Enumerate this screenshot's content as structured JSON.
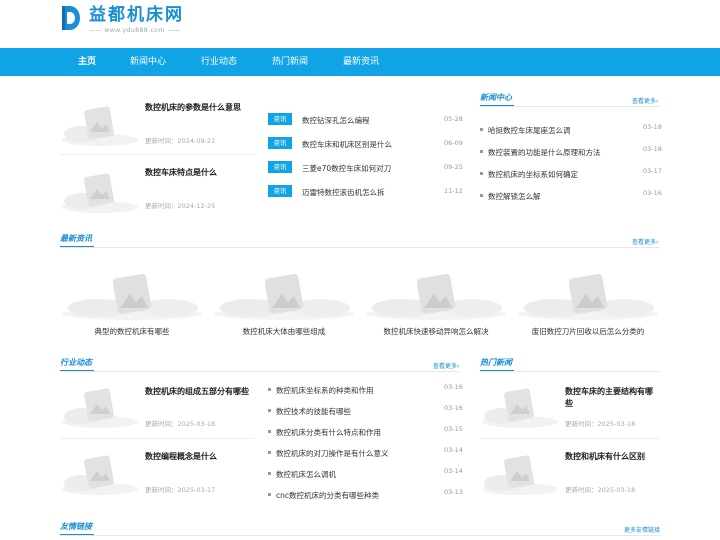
{
  "site": {
    "name": "益都机床网",
    "url": "—— www.ydu888.com ——"
  },
  "nav": [
    {
      "label": "主页"
    },
    {
      "label": "新闻中心"
    },
    {
      "label": "行业动态"
    },
    {
      "label": "热门新闻"
    },
    {
      "label": "最新资讯"
    }
  ],
  "top": {
    "cards": [
      {
        "title": "数控机床的参数是什么意思",
        "time": "更新时间：2024-09-21"
      },
      {
        "title": "数控车床特点是什么",
        "time": "更新时间：2024-12-25"
      }
    ],
    "list": [
      {
        "badge": "资讯",
        "title": "数控钻深孔怎么编程",
        "date": "05-28"
      },
      {
        "badge": "资讯",
        "title": "数控车床和机床区别是什么",
        "date": "06-09"
      },
      {
        "badge": "资讯",
        "title": "三菱e70数控车床如何对刀",
        "date": "09-25"
      },
      {
        "badge": "资讯",
        "title": "迈雷特数控滚齿机怎么拆",
        "date": "11-12"
      }
    ]
  },
  "news_center": {
    "title": "新闻中心",
    "more": "查看更多›",
    "items": [
      {
        "title": "哈挺数控车床尾座怎么调",
        "date": "03-18"
      },
      {
        "title": "数控装置的功能是什么原理和方法",
        "date": "03-18"
      },
      {
        "title": "数控机床的坐标系如何确定",
        "date": "03-17"
      },
      {
        "title": "数控解锁怎么解",
        "date": "03-16"
      }
    ]
  },
  "latest": {
    "title": "最新资讯",
    "more": "查看更多›",
    "items": [
      {
        "caption": "典型的数控机床有哪些"
      },
      {
        "caption": "数控机床大体由哪些组成"
      },
      {
        "caption": "数控机床快速移动异响怎么解决"
      },
      {
        "caption": "废旧数控刀片回收以后怎么分类的"
      }
    ]
  },
  "industry": {
    "title": "行业动态",
    "more": "查看更多›",
    "cards": [
      {
        "title": "数控机床的组成五部分有哪些",
        "time": "更新时间：2025-03-18"
      },
      {
        "title": "数控编程概念是什么",
        "time": "更新时间：2025-03-17"
      }
    ],
    "list": [
      {
        "title": "数控机床坐标系的种类和作用",
        "date": "03-16"
      },
      {
        "title": "数控技术的技能有哪些",
        "date": "03-16"
      },
      {
        "title": "数控机床分类有什么特点和作用",
        "date": "03-15"
      },
      {
        "title": "数控机床的对刀操作是有什么意义",
        "date": "03-14"
      },
      {
        "title": "数控机床怎么调机",
        "date": "03-14"
      },
      {
        "title": "cnc数控机床的分类有哪些种类",
        "date": "03-13"
      }
    ]
  },
  "hot": {
    "title": "热门新闻",
    "cards": [
      {
        "title": "数控车床的主要结构有哪些",
        "time": "更新时间：2025-03-18"
      },
      {
        "title": "数控和机床有什么区别",
        "time": "更新时间：2025-03-18"
      }
    ]
  },
  "links": {
    "title": "友情链接",
    "more": "更多友情链接"
  },
  "colors": {
    "accent": "#10a4e6",
    "brand": "#1a8ed4"
  }
}
